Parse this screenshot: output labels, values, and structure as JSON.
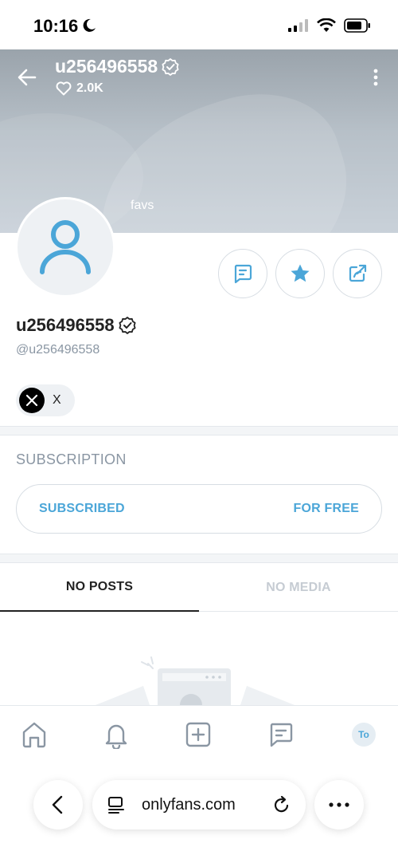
{
  "status_bar": {
    "time": "10:16"
  },
  "header": {
    "username": "u256496558",
    "likes": "2.0K",
    "cover_caption": "favs"
  },
  "profile": {
    "name": "u256496558",
    "handle": "@u256496558"
  },
  "social": {
    "label": "X"
  },
  "subscription": {
    "section_title": "SUBSCRIPTION",
    "status": "SUBSCRIBED",
    "price": "FOR FREE"
  },
  "tabs": [
    {
      "label": "NO POSTS"
    },
    {
      "label": "NO MEDIA"
    }
  ],
  "bottom_nav": {
    "avatar_initials": "To"
  },
  "browser": {
    "url": "onlyfans.com"
  },
  "colors": {
    "accent": "#4ba6d8",
    "muted": "#8a96a3",
    "cover": "#b7c0c8"
  }
}
